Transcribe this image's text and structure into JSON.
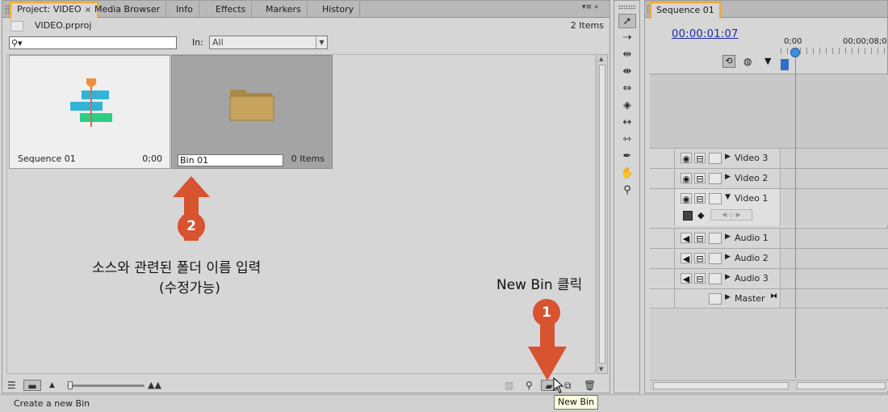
{
  "project_panel": {
    "tabs": [
      {
        "label": "Project: VIDEO",
        "active": true
      },
      {
        "label": "Media Browser"
      },
      {
        "label": "Info"
      },
      {
        "label": "Effects"
      },
      {
        "label": "Markers"
      },
      {
        "label": "History"
      }
    ],
    "close_glyph": "×",
    "filename": "VIDEO.prproj",
    "item_count": "2 Items",
    "search": {
      "glass": "⚲▾",
      "value": ""
    },
    "in_label": "In:",
    "in_select": "All",
    "items": [
      {
        "name": "Sequence 01",
        "meta": "0;00",
        "icon": "sequence-icon"
      },
      {
        "name": "Bin 01",
        "meta": "0 Items",
        "icon": "folder-icon",
        "editing": true
      }
    ]
  },
  "annotations": {
    "badge1": "1",
    "badge2": "2",
    "new_bin_click": "New Bin 클릭",
    "rename_line1": "소스와 관련된 폴더 이름 입력",
    "rename_line2": "(수정가능)",
    "arrow_color": "#d8532f"
  },
  "tooltip": "New Bin",
  "status_text": "Create a new Bin",
  "sequence_panel": {
    "tab": "Sequence 01",
    "timecode": "00:00:01:07",
    "ruler_labels": [
      "0;00",
      "00;00;08;0"
    ],
    "tracks": [
      {
        "name": "Video 3",
        "type": "video"
      },
      {
        "name": "Video 2",
        "type": "video"
      },
      {
        "name": "Video 1",
        "type": "video",
        "expanded": true
      },
      {
        "name": "Audio 1",
        "type": "audio"
      },
      {
        "name": "Audio 2",
        "type": "audio"
      },
      {
        "name": "Audio 3",
        "type": "audio"
      },
      {
        "name": "Master",
        "type": "master"
      }
    ]
  },
  "tools": [
    "selection-tool",
    "track-select-tool",
    "ripple-edit-tool",
    "rolling-edit-tool",
    "rate-stretch-tool",
    "razor-tool",
    "slip-tool",
    "slide-tool",
    "pen-tool",
    "hand-tool",
    "zoom-tool"
  ]
}
